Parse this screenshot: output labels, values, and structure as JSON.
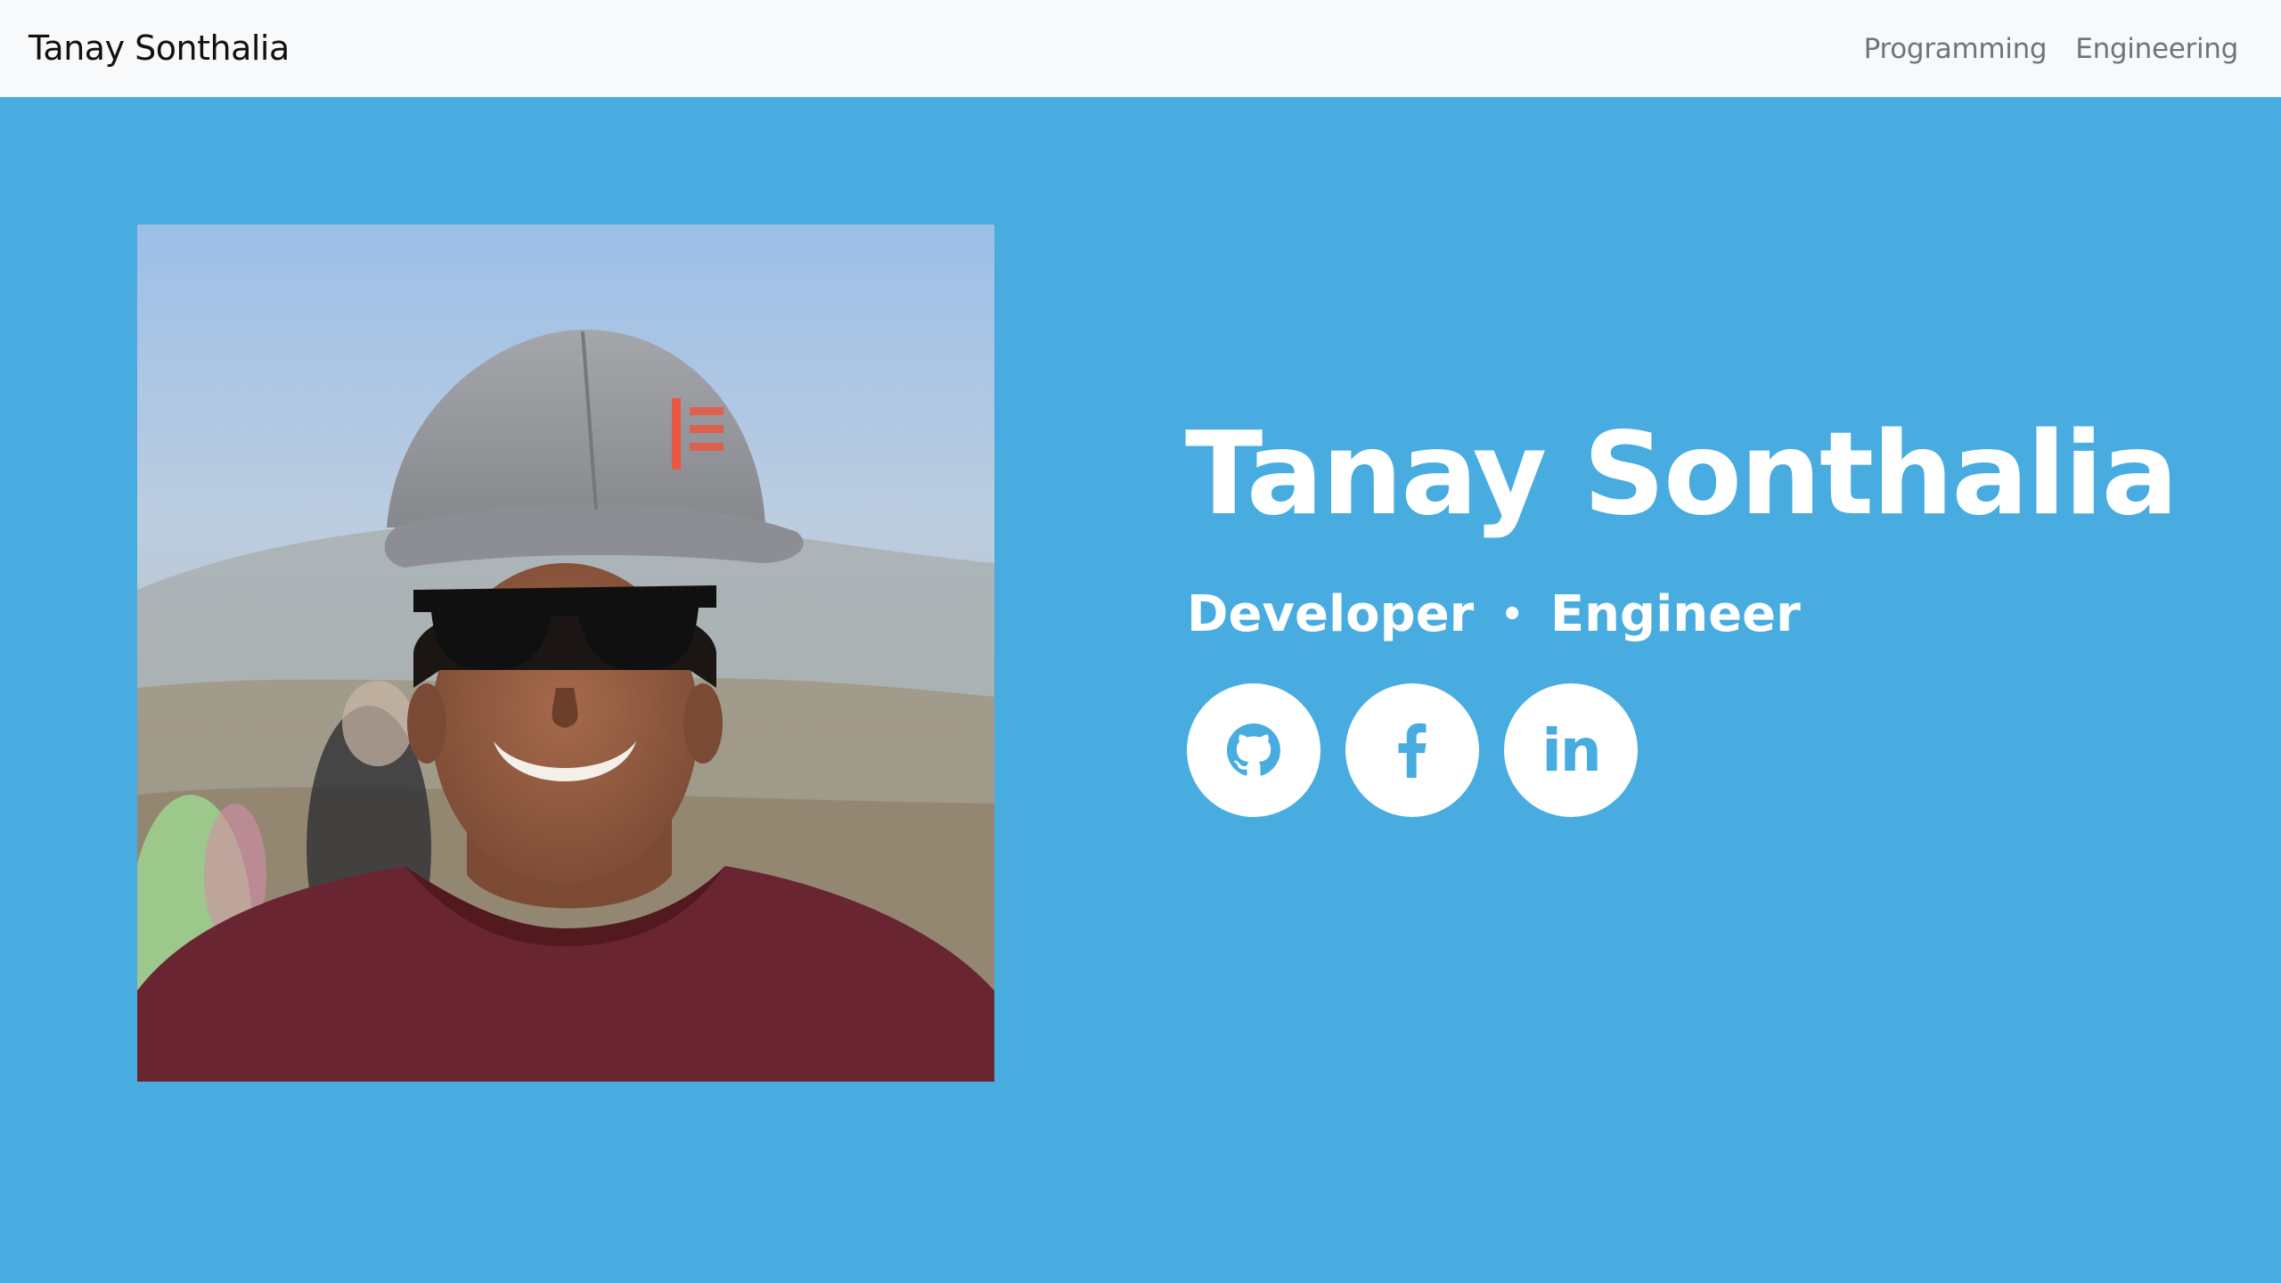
{
  "colors": {
    "hero_background": "#48ace0",
    "navbar_background": "#f8f9fa",
    "accent": "#48ace0"
  },
  "navbar": {
    "brand": "Tanay Sonthalia",
    "links": [
      {
        "label": "Programming"
      },
      {
        "label": "Engineering"
      }
    ]
  },
  "hero": {
    "name": "Tanay Sonthalia",
    "roles": [
      "Developer",
      "Engineer"
    ],
    "separator": "•",
    "socials": [
      {
        "icon": "github-icon"
      },
      {
        "icon": "facebook-icon"
      },
      {
        "icon": "linkedin-icon",
        "glyph": "in"
      }
    ]
  }
}
